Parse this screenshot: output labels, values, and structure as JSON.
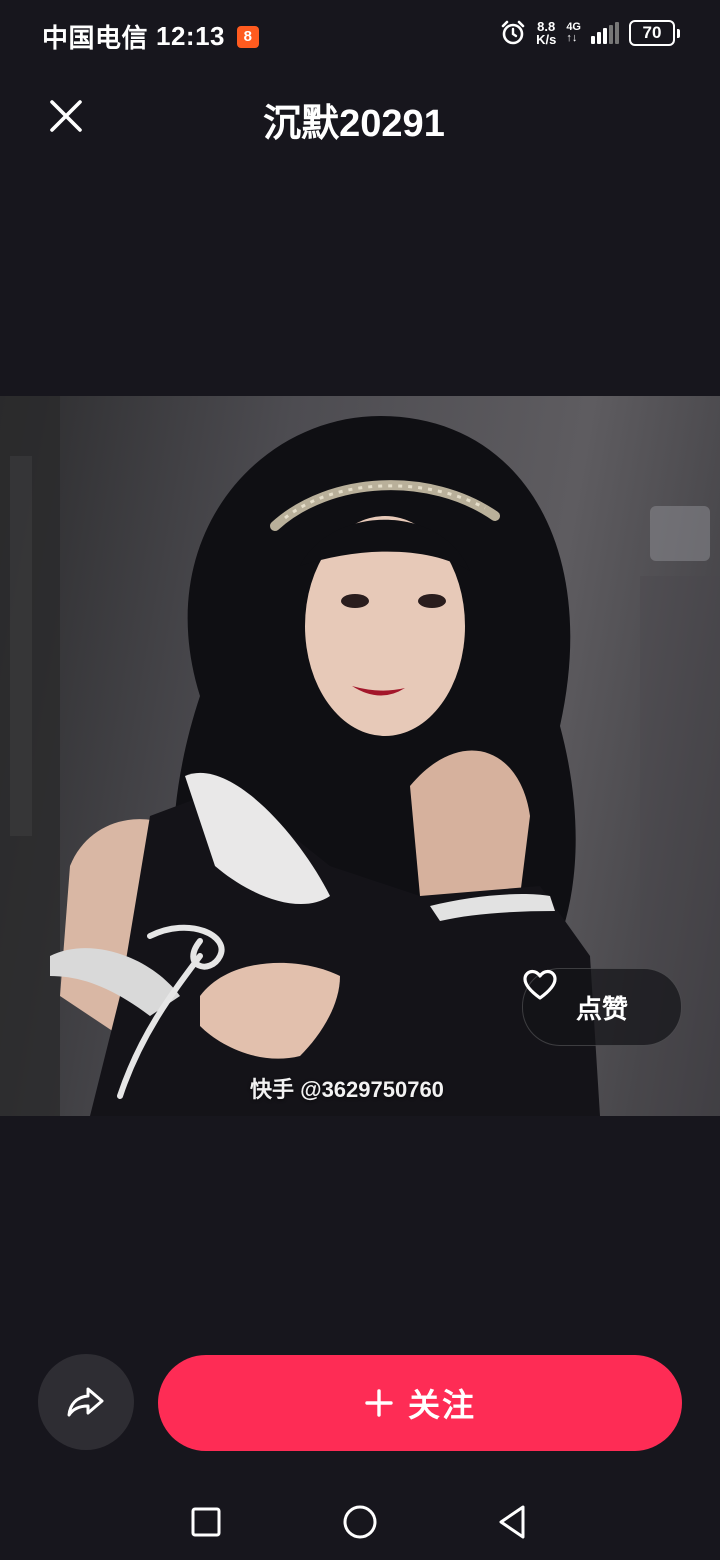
{
  "status_bar": {
    "carrier": "中国电信",
    "time": "12:13",
    "app_badge": "8",
    "net_speed_value": "8.8",
    "net_speed_unit": "K/s",
    "net_type": "4G",
    "battery": "70",
    "icons": [
      "alarm-icon",
      "signal-icon",
      "battery-icon"
    ]
  },
  "header": {
    "title": "沉默20291",
    "close_icon": "close-icon"
  },
  "photo": {
    "watermark": "快手 @3629750760",
    "like_label": "点赞",
    "like_icon": "heart-outline-icon"
  },
  "actions": {
    "share_icon": "share-arrow-icon",
    "follow_label": "关注",
    "follow_icon": "plus-icon",
    "follow_color": "#fe2c55"
  },
  "nav": {
    "icons": [
      "recent-apps-icon",
      "home-icon",
      "back-icon"
    ]
  },
  "colors": {
    "background": "#17161d",
    "accent": "#fe2c55",
    "share_bg": "#2e2d33"
  }
}
